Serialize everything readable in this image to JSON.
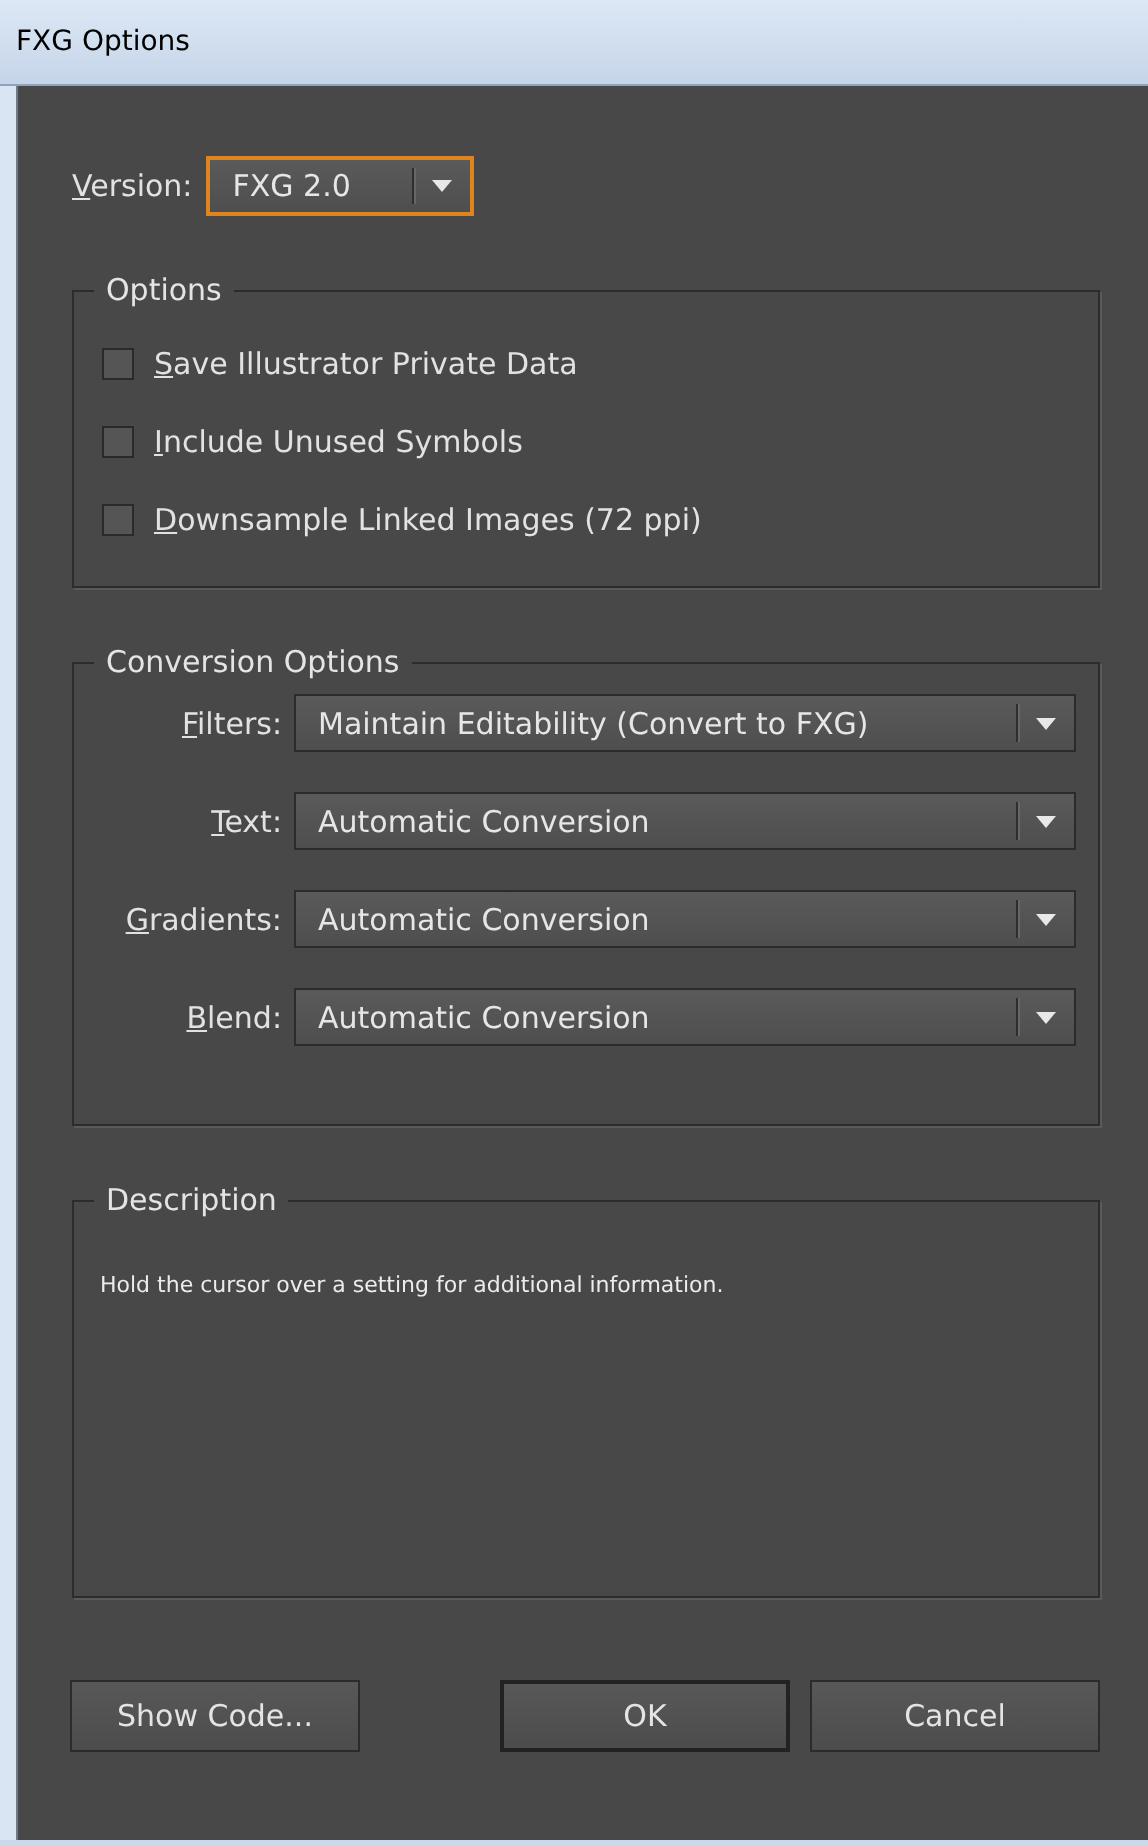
{
  "window": {
    "title": "FXG Options"
  },
  "version": {
    "label": "Version:",
    "value": "FXG 2.0",
    "focused": true
  },
  "options": {
    "title": "Options",
    "items": [
      {
        "label": "Save Illustrator Private Data",
        "checked": false
      },
      {
        "label": "Include Unused Symbols",
        "checked": false
      },
      {
        "label": "Downsample Linked Images (72 ppi)",
        "checked": false
      }
    ]
  },
  "conversion_options": {
    "title": "Conversion Options",
    "rows": [
      {
        "label": "Filters:",
        "value": "Maintain Editability (Convert to FXG)"
      },
      {
        "label": "Text:",
        "value": "Automatic Conversion"
      },
      {
        "label": "Gradients:",
        "value": "Automatic Conversion"
      },
      {
        "label": "Blend:",
        "value": "Automatic Conversion"
      }
    ]
  },
  "description": {
    "title": "Description",
    "text": "Hold the cursor over a setting for additional information."
  },
  "buttons": [
    {
      "label": "Show Code...",
      "default": false
    },
    {
      "label": "OK",
      "default": true
    },
    {
      "label": "Cancel",
      "default": false
    }
  ]
}
